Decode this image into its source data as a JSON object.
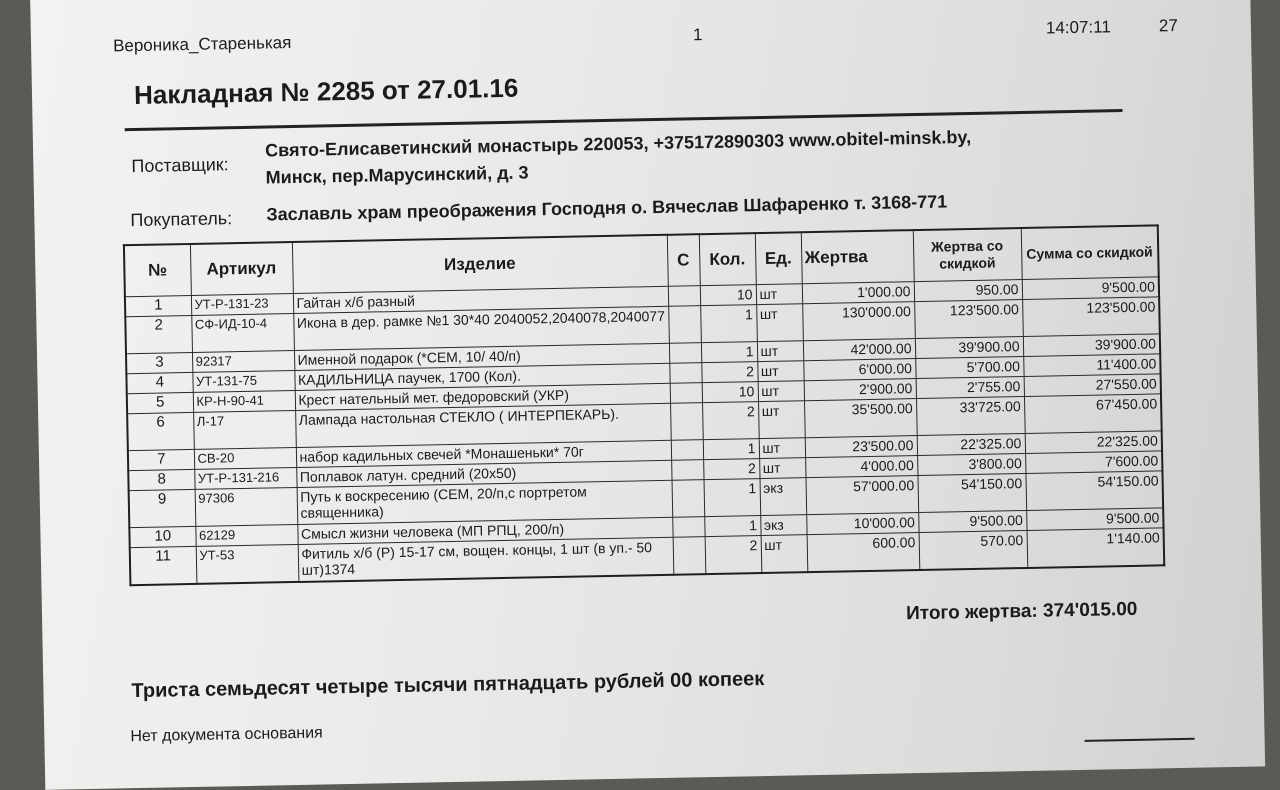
{
  "header": {
    "author": "Вероника_Старенькая",
    "page": "1",
    "time": "14:07:11",
    "day": "27"
  },
  "title": "Накладная № 2285 от 27.01.16",
  "supplier": {
    "label": "Поставщик:",
    "line1": "Свято-Елисаветинский монастырь 220053, +375172890303 www.obitel-minsk.by,",
    "line2": "Минск, пер.Марусинский, д. 3"
  },
  "buyer": {
    "label": "Покупатель:",
    "value": "Заславль храм преображения Господня о. Вячеслав Шафаренко т. 3168-771"
  },
  "table": {
    "headers": [
      "№",
      "Артикул",
      "Изделие",
      "С",
      "Кол.",
      "Ед.",
      "Жертва",
      "Жертва со скидкой",
      "Сумма со скидкой"
    ],
    "rows": [
      {
        "n": "1",
        "art": "УТ-Р-131-23",
        "name": "Гайтан х/б разный",
        "c": "",
        "qty": "10",
        "unit": "шт",
        "price": "1'000.00",
        "disc": "950.00",
        "sum": "9'500.00"
      },
      {
        "n": "2",
        "art": "СФ-ИД-10-4",
        "name": "Икона в дер. рамке №1 30*40 2040052,2040078,2040077",
        "c": "",
        "qty": "1",
        "unit": "шт",
        "price": "130'000.00",
        "disc": "123'500.00",
        "sum": "123'500.00"
      },
      {
        "n": "3",
        "art": "92317",
        "name": "Именной подарок (*СЕМ, 10/ 40/п)",
        "c": "",
        "qty": "1",
        "unit": "шт",
        "price": "42'000.00",
        "disc": "39'900.00",
        "sum": "39'900.00"
      },
      {
        "n": "4",
        "art": "УТ-131-75",
        "name": "КАДИЛЬНИЦА паучек, 1700 (Кол).",
        "c": "",
        "qty": "2",
        "unit": "шт",
        "price": "6'000.00",
        "disc": "5'700.00",
        "sum": "11'400.00"
      },
      {
        "n": "5",
        "art": "КР-Н-90-41",
        "name": "Крест нательный мет. федоровский (УКР)",
        "c": "",
        "qty": "10",
        "unit": "шт",
        "price": "2'900.00",
        "disc": "2'755.00",
        "sum": "27'550.00"
      },
      {
        "n": "6",
        "art": "Л-17",
        "name": "Лампада настольная СТЕКЛО ( ИНТЕРПЕКАРЬ).",
        "c": "",
        "qty": "2",
        "unit": "шт",
        "price": "35'500.00",
        "disc": "33'725.00",
        "sum": "67'450.00"
      },
      {
        "n": "7",
        "art": "СВ-20",
        "name": "набор кадильных свечей *Монашеньки* 70г",
        "c": "",
        "qty": "1",
        "unit": "шт",
        "price": "23'500.00",
        "disc": "22'325.00",
        "sum": "22'325.00"
      },
      {
        "n": "8",
        "art": "УТ-Р-131-216",
        "name": "Поплавок латун. средний (20х50)",
        "c": "",
        "qty": "2",
        "unit": "шт",
        "price": "4'000.00",
        "disc": "3'800.00",
        "sum": "7'600.00"
      },
      {
        "n": "9",
        "art": "97306",
        "name": "Путь к воскресению (СЕМ, 20/п,с портретом священника)",
        "c": "",
        "qty": "1",
        "unit": "экз",
        "price": "57'000.00",
        "disc": "54'150.00",
        "sum": "54'150.00"
      },
      {
        "n": "10",
        "art": "62129",
        "name": "Смысл жизни человека (МП РПЦ, 200/п)",
        "c": "",
        "qty": "1",
        "unit": "экз",
        "price": "10'000.00",
        "disc": "9'500.00",
        "sum": "9'500.00"
      },
      {
        "n": "11",
        "art": "УТ-53",
        "name": "Фитиль х/б (Р) 15-17 см, вощен. концы, 1 шт (в уп.- 50 шт)1374",
        "c": "",
        "qty": "2",
        "unit": "шт",
        "price": "600.00",
        "disc": "570.00",
        "sum": "1'140.00"
      }
    ]
  },
  "total": "Итого жертва: 374'015.00",
  "amount_words": "Триста семьдесят четыре тысячи пятнадцать рублей 00 копеек",
  "basis": "Нет документа основания"
}
